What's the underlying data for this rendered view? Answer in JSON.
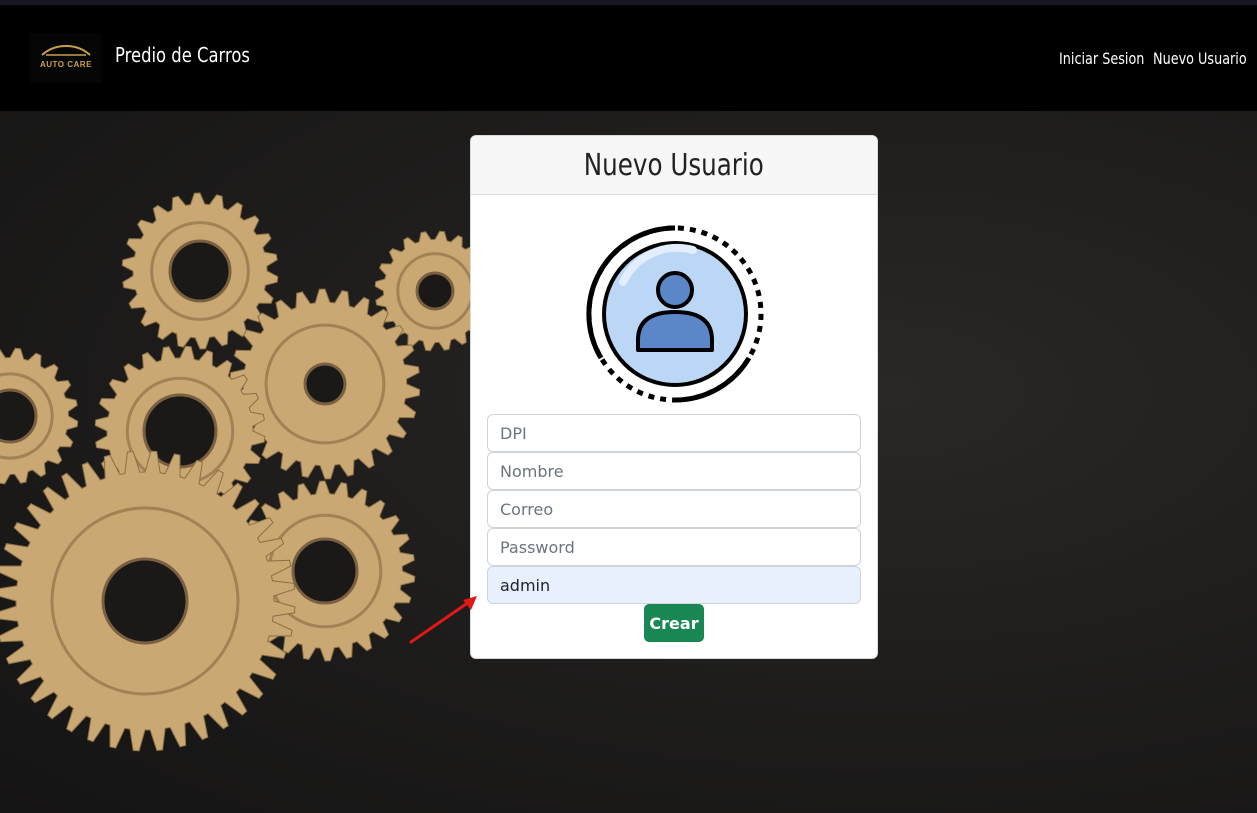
{
  "navbar": {
    "logo_text": "AUTO CARE",
    "brand": "Predio de Carros",
    "links": [
      "Iniciar Sesion",
      "Nuevo Usuario"
    ]
  },
  "card": {
    "title": "Nuevo Usuario",
    "fields": [
      {
        "placeholder": "DPI",
        "value": ""
      },
      {
        "placeholder": "Nombre",
        "value": ""
      },
      {
        "placeholder": "Correo",
        "value": ""
      },
      {
        "placeholder": "Password",
        "value": ""
      },
      {
        "placeholder": "",
        "value": "admin"
      }
    ],
    "submit_label": "Crear"
  },
  "icons": {
    "avatar": "user-circle-icon",
    "logo": "car-logo-icon",
    "annotation": "red-arrow-icon"
  },
  "colors": {
    "navbar": "#000000",
    "button": "#198754",
    "autofill": "#e8f0fe",
    "gear": "#c9a874",
    "arrow": "#e01818"
  }
}
